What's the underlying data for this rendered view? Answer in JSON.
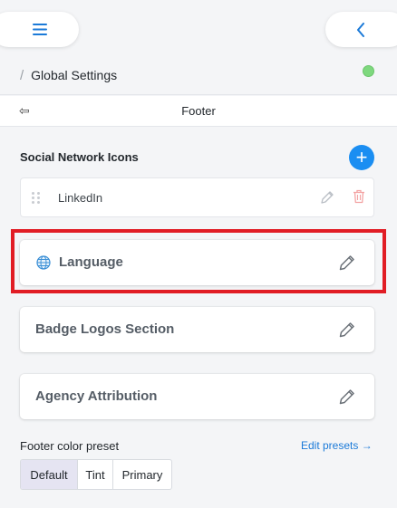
{
  "topbar": {
    "menu_icon": "hamburger-menu-icon",
    "back_icon": "chevron-left-icon"
  },
  "breadcrumb": {
    "separator": "/",
    "title": "Global Settings",
    "status_color": "#7ed87e"
  },
  "panel": {
    "back_icon": "back-arrow-icon",
    "back_glyph": "⇦",
    "title": "Footer"
  },
  "social": {
    "title": "Social Network Icons",
    "add_glyph": "+",
    "items": [
      {
        "label": "LinkedIn"
      }
    ]
  },
  "sections": [
    {
      "label": "Language",
      "icon": "globe-icon",
      "highlighted": true
    },
    {
      "label": "Badge Logos Section"
    },
    {
      "label": "Agency Attribution"
    }
  ],
  "footer_color": {
    "label": "Footer color preset",
    "edit_link": "Edit presets →",
    "options": [
      "Default",
      "Tint",
      "Primary"
    ],
    "selected": "Default"
  },
  "colors": {
    "accent": "#1b8ef2",
    "highlight_border": "#e11d25",
    "delete": "#f3a3a3"
  }
}
